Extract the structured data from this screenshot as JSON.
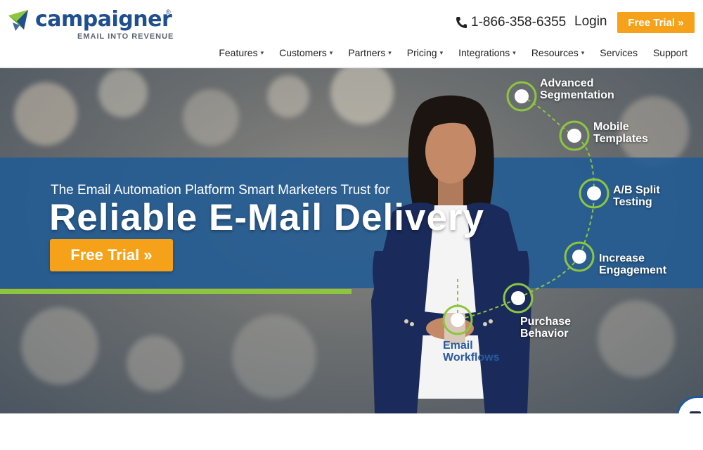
{
  "brand": {
    "name": "campaigner",
    "registered": "®",
    "tagline": "EMAIL INTO REVENUE"
  },
  "header": {
    "phone": "1-866-358-6355",
    "login_label": "Login",
    "trial_label": "Free Trial »"
  },
  "nav": {
    "items": [
      {
        "label": "Features",
        "dropdown": true
      },
      {
        "label": "Customers",
        "dropdown": true
      },
      {
        "label": "Partners",
        "dropdown": true
      },
      {
        "label": "Pricing",
        "dropdown": true
      },
      {
        "label": "Integrations",
        "dropdown": true
      },
      {
        "label": "Resources",
        "dropdown": true
      },
      {
        "label": "Services",
        "dropdown": false
      },
      {
        "label": "Support",
        "dropdown": false
      }
    ],
    "caret": "▾"
  },
  "hero": {
    "subtitle": "The Email Automation Platform Smart Marketers Trust for",
    "title": "Reliable E-Mail Delivery",
    "button_label": "Free Trial »"
  },
  "steps": [
    {
      "line1": "Advanced",
      "line2": "Segmentation"
    },
    {
      "line1": "Mobile",
      "line2": "Templates"
    },
    {
      "line1": "A/B Split",
      "line2": "Testing"
    },
    {
      "line1": "Increase",
      "line2": "Engagement"
    },
    {
      "line1": "Purchase",
      "line2": "Behavior"
    },
    {
      "line1": "Email",
      "line2": "Workflows"
    }
  ],
  "colors": {
    "brand_blue": "#1f4f8f",
    "accent_orange": "#f5a11a",
    "accent_green": "#8cc63f",
    "band_blue": "#215b94"
  },
  "icons": {
    "phone": "phone-icon",
    "chat": "chat-icon",
    "logo": "envelope-logo-icon"
  }
}
